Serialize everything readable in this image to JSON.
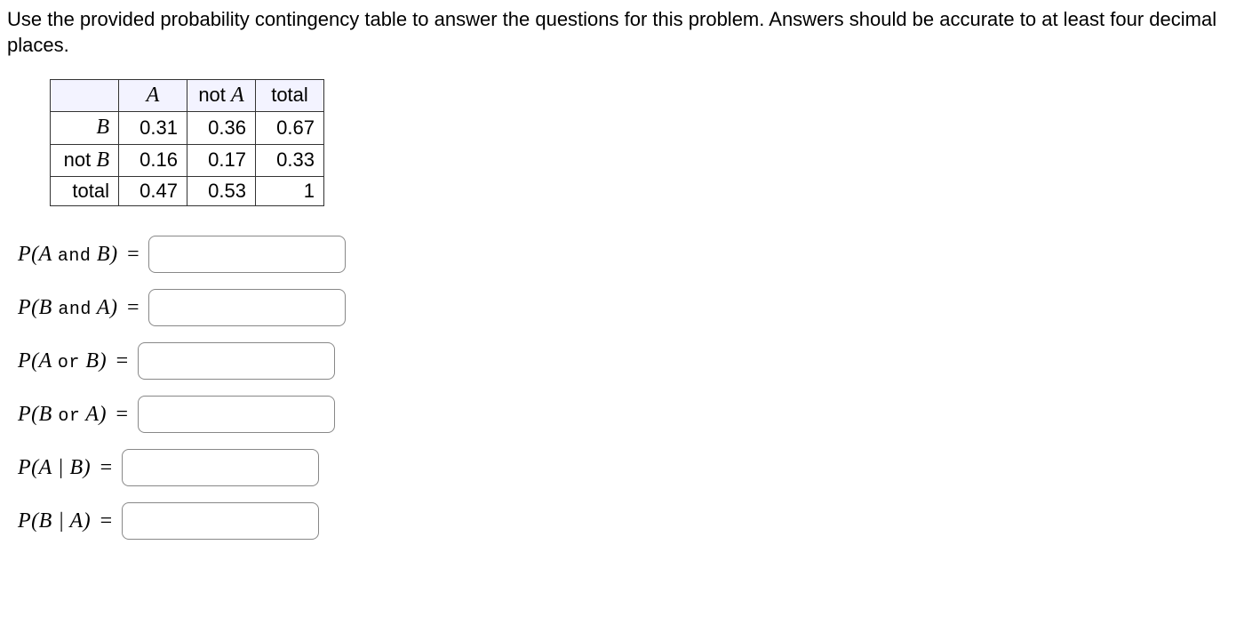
{
  "instructions": "Use the provided probability contingency table to answer the questions for this problem. Answers should be accurate to at least four decimal places.",
  "table": {
    "cols": [
      "A",
      "not A",
      "total"
    ],
    "rows": [
      {
        "head": "B",
        "vals": [
          "0.31",
          "0.36",
          "0.67"
        ]
      },
      {
        "head": "not B",
        "vals": [
          "0.16",
          "0.17",
          "0.33"
        ]
      },
      {
        "head": "total",
        "vals": [
          "0.47",
          "0.53",
          "1"
        ]
      }
    ]
  },
  "questions": [
    {
      "lhs_html": "P(A <span class=\"op\">and</span> B) <span class=\"eq\">=</span>"
    },
    {
      "lhs_html": "P(B <span class=\"op\">and</span> A) <span class=\"eq\">=</span>"
    },
    {
      "lhs_html": "P(A <span class=\"op\">or</span> B) <span class=\"eq\">=</span>"
    },
    {
      "lhs_html": "P(B <span class=\"op\">or</span> A) <span class=\"eq\">=</span>"
    },
    {
      "lhs_html": "P(A | B) <span class=\"eq\">=</span>"
    },
    {
      "lhs_html": "P(B | A) <span class=\"eq\">=</span>"
    }
  ],
  "question_names": [
    "p-a-and-b",
    "p-b-and-a",
    "p-a-or-b",
    "p-b-or-a",
    "p-a-given-b",
    "p-b-given-a"
  ]
}
